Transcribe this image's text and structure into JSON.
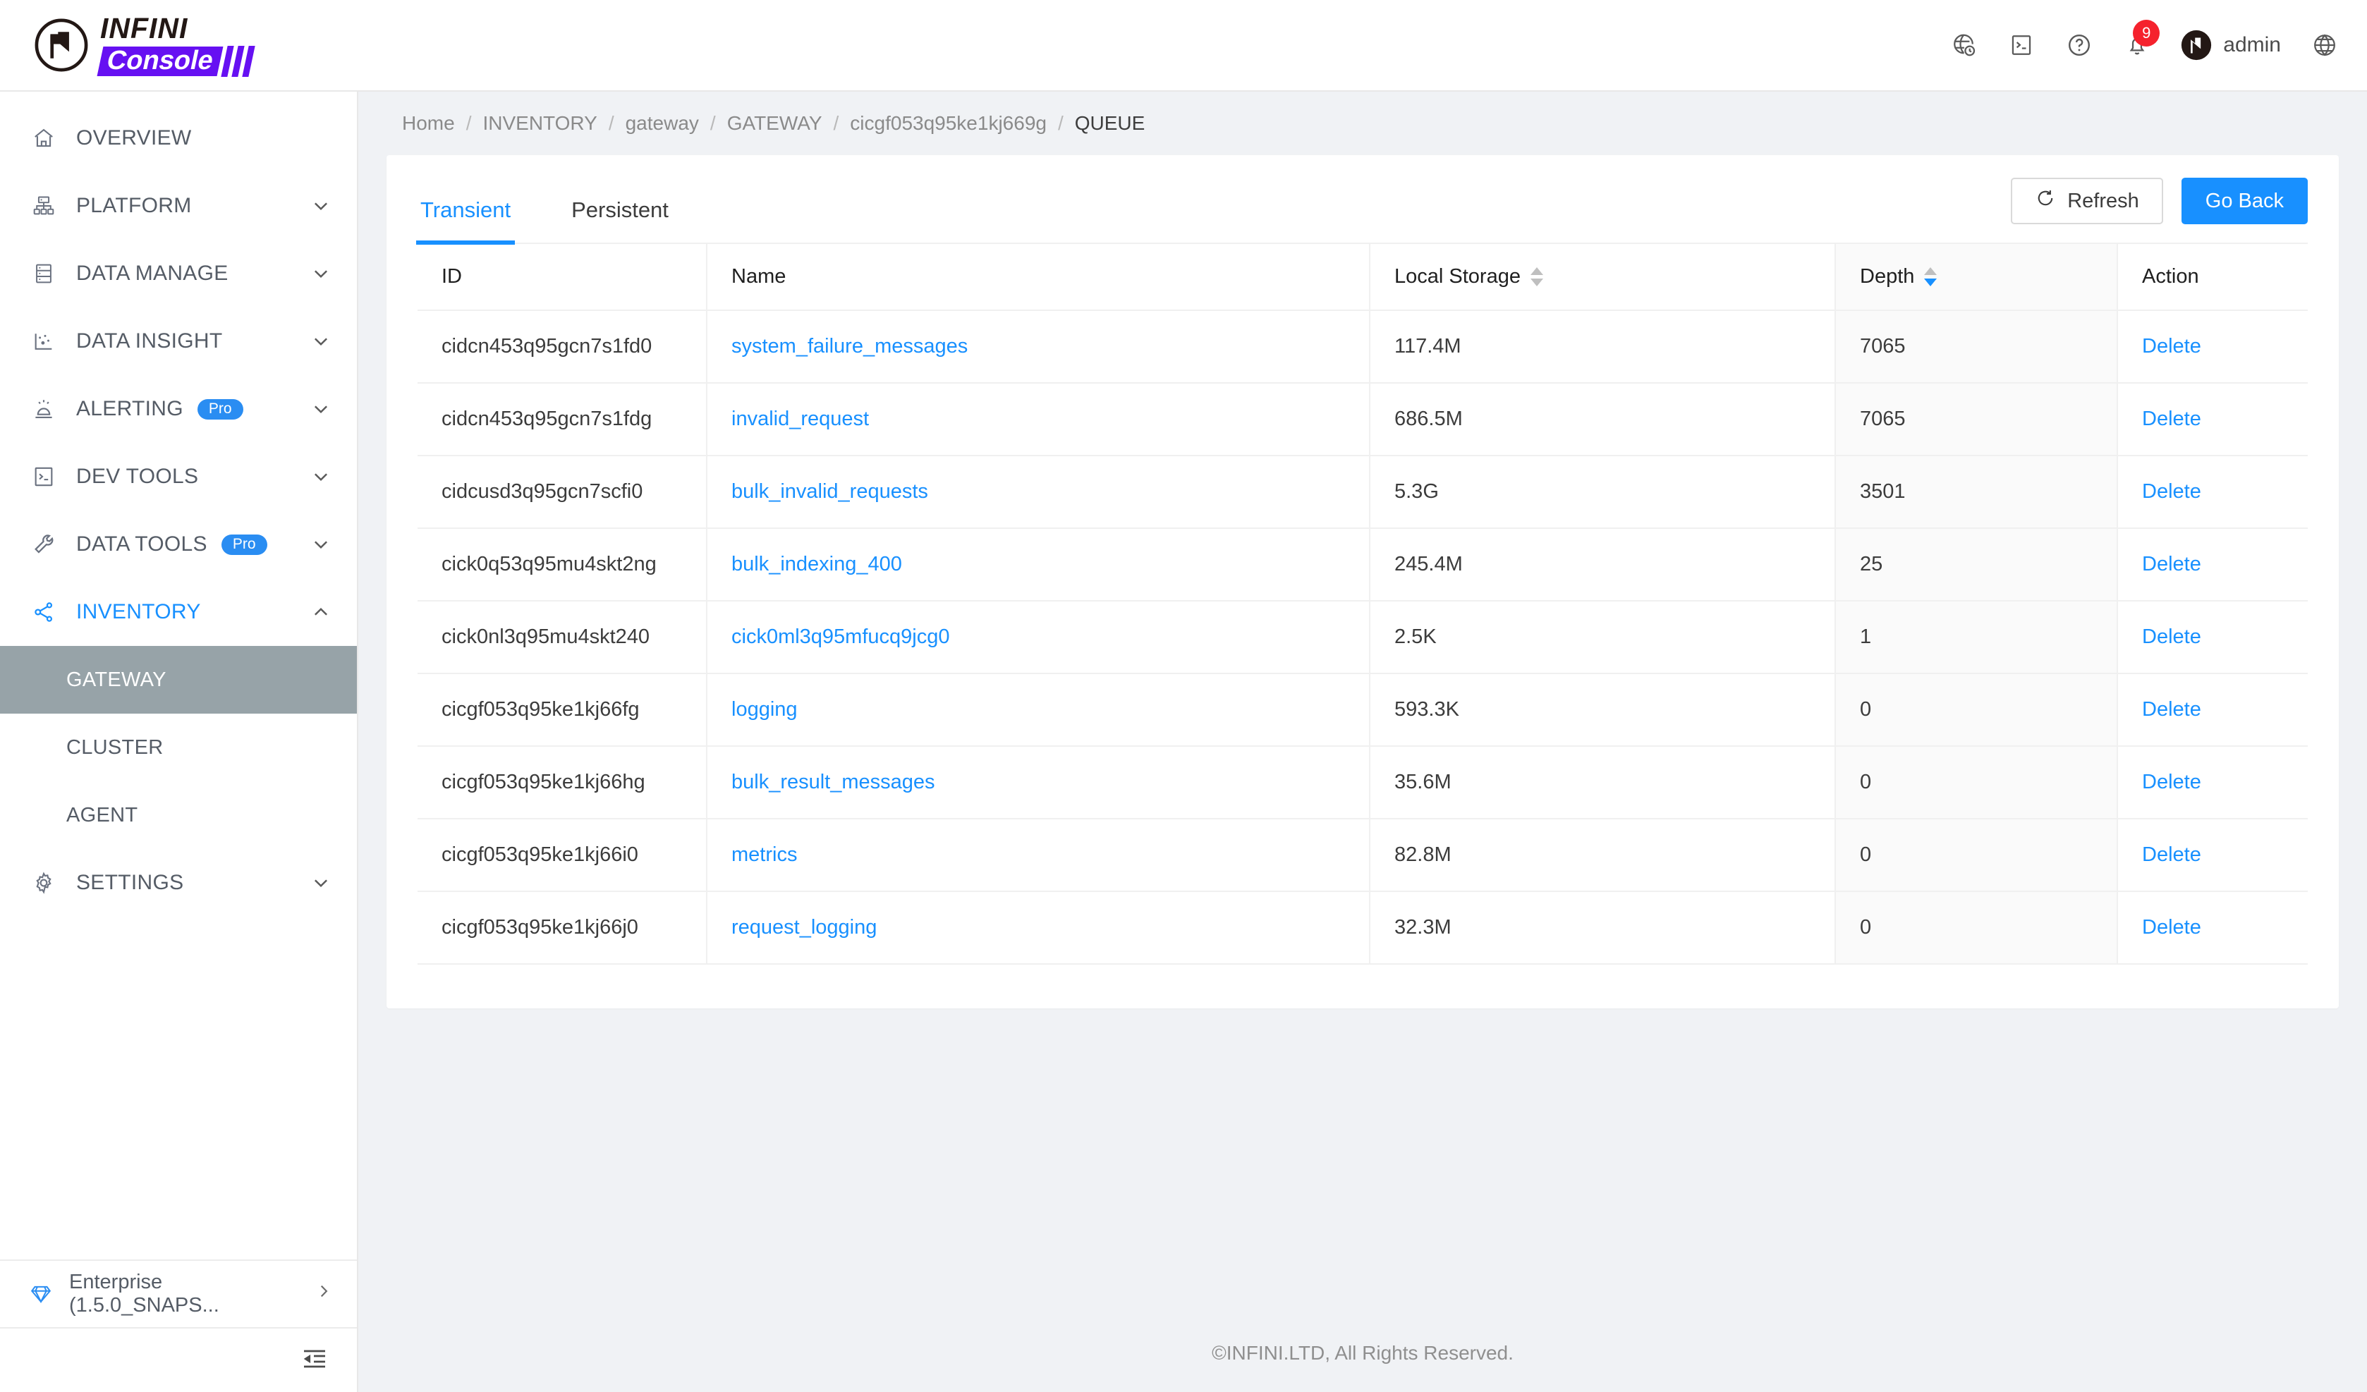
{
  "brand": {
    "name_top": "INFINI",
    "name_bottom": "Console",
    "logo_color": "#6610f2"
  },
  "header": {
    "icons": [
      {
        "name": "activity-globe-icon",
        "glyph": "globe-clock"
      },
      {
        "name": "console-terminal-icon",
        "glyph": "terminal"
      },
      {
        "name": "help-question-icon",
        "glyph": "question"
      },
      {
        "name": "notification-bell-icon",
        "glyph": "bell"
      }
    ],
    "notification_count": "9",
    "user": "admin",
    "language_icon": "globe-icon"
  },
  "sidebar": {
    "items": [
      {
        "label": "OVERVIEW",
        "icon": "home-icon",
        "chevron": "",
        "pro": false,
        "active": false
      },
      {
        "label": "PLATFORM",
        "icon": "sitemap-icon",
        "chevron": "down",
        "pro": false,
        "active": false
      },
      {
        "label": "DATA MANAGE",
        "icon": "database-icon",
        "chevron": "down",
        "pro": false,
        "active": false
      },
      {
        "label": "DATA INSIGHT",
        "icon": "scatter-icon",
        "chevron": "down",
        "pro": false,
        "active": false
      },
      {
        "label": "ALERTING",
        "icon": "alarm-icon",
        "chevron": "down",
        "pro": true,
        "active": false
      },
      {
        "label": "DEV TOOLS",
        "icon": "terminal-icon",
        "chevron": "down",
        "pro": false,
        "active": false
      },
      {
        "label": "DATA TOOLS",
        "icon": "wrench-icon",
        "chevron": "down",
        "pro": true,
        "active": false
      },
      {
        "label": "INVENTORY",
        "icon": "share-nodes-icon",
        "chevron": "up",
        "pro": false,
        "active": true
      }
    ],
    "pro_label": "Pro",
    "inventory_children": [
      {
        "label": "GATEWAY",
        "selected": true
      },
      {
        "label": "CLUSTER",
        "selected": false
      },
      {
        "label": "AGENT",
        "selected": false
      }
    ],
    "settings": {
      "label": "SETTINGS",
      "icon": "gear-icon",
      "chevron": "down"
    },
    "license": {
      "label": "Enterprise (1.5.0_SNAPS...",
      "icon": "diamond-icon",
      "arrow": "chevron-right"
    },
    "collapse_icon": "collapse-sidebar-icon"
  },
  "breadcrumb": [
    {
      "label": "Home",
      "current": false
    },
    {
      "label": "INVENTORY",
      "current": false
    },
    {
      "label": "gateway",
      "current": false
    },
    {
      "label": "GATEWAY",
      "current": false
    },
    {
      "label": "cicgf053q95ke1kj669g",
      "current": false
    },
    {
      "label": "QUEUE",
      "current": true
    }
  ],
  "breadcrumb_separator": "/",
  "tabs": [
    {
      "label": "Transient",
      "active": true
    },
    {
      "label": "Persistent",
      "active": false
    }
  ],
  "actions": {
    "refresh_label": "Refresh",
    "refresh_icon": "refresh-icon",
    "go_back_label": "Go Back"
  },
  "table": {
    "columns": [
      {
        "label": "ID",
        "sortable": false,
        "sort": "none"
      },
      {
        "label": "Name",
        "sortable": false,
        "sort": "none"
      },
      {
        "label": "Local Storage",
        "sortable": true,
        "sort": "none"
      },
      {
        "label": "Depth",
        "sortable": true,
        "sort": "desc"
      },
      {
        "label": "Action",
        "sortable": false,
        "sort": "none"
      }
    ],
    "delete_label": "Delete",
    "rows": [
      {
        "id": "cidcn453q95gcn7s1fd0",
        "name": "system_failure_messages",
        "local_storage": "117.4M",
        "depth": "7065"
      },
      {
        "id": "cidcn453q95gcn7s1fdg",
        "name": "invalid_request",
        "local_storage": "686.5M",
        "depth": "7065"
      },
      {
        "id": "cidcusd3q95gcn7scfi0",
        "name": "bulk_invalid_requests",
        "local_storage": "5.3G",
        "depth": "3501"
      },
      {
        "id": "cick0q53q95mu4skt2ng",
        "name": "bulk_indexing_400",
        "local_storage": "245.4M",
        "depth": "25"
      },
      {
        "id": "cick0nl3q95mu4skt240",
        "name": "cick0ml3q95mfucq9jcg0",
        "local_storage": "2.5K",
        "depth": "1"
      },
      {
        "id": "cicgf053q95ke1kj66fg",
        "name": "logging",
        "local_storage": "593.3K",
        "depth": "0"
      },
      {
        "id": "cicgf053q95ke1kj66hg",
        "name": "bulk_result_messages",
        "local_storage": "35.6M",
        "depth": "0"
      },
      {
        "id": "cicgf053q95ke1kj66i0",
        "name": "metrics",
        "local_storage": "82.8M",
        "depth": "0"
      },
      {
        "id": "cicgf053q95ke1kj66j0",
        "name": "request_logging",
        "local_storage": "32.3M",
        "depth": "0"
      }
    ]
  },
  "footer": {
    "copyright": "©INFINI.LTD, All Rights Reserved."
  },
  "colors": {
    "accent": "#1890ff",
    "brand_purple": "#6610f2",
    "badge_red": "#f5222d",
    "selected_gray": "#97a3a8"
  }
}
